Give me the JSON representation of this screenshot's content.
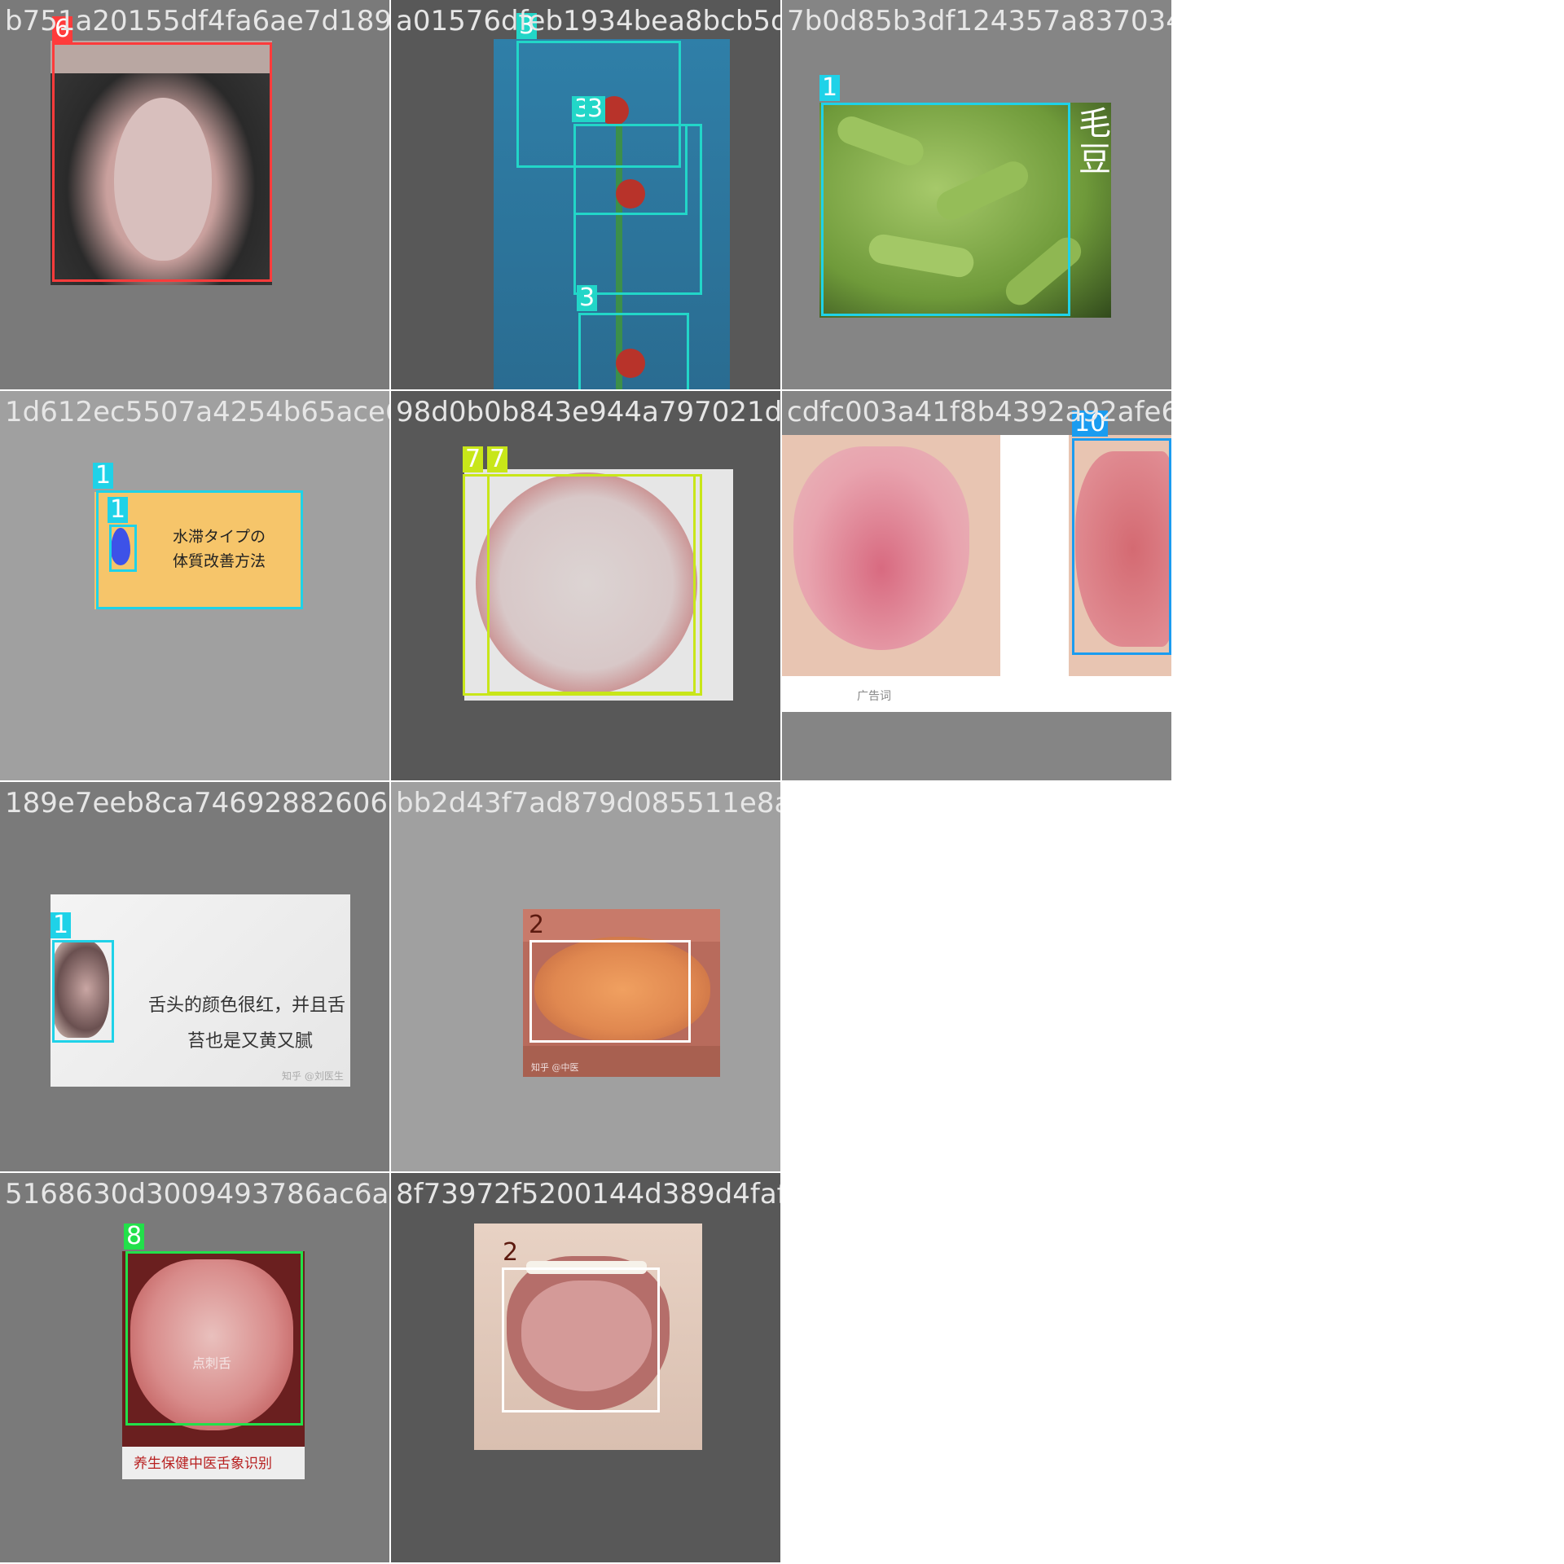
{
  "cells": [
    {
      "filename": "b751a20155df4fa6ae7d1892af2133afd.jpg",
      "tags": [
        "6"
      ]
    },
    {
      "filename": "a01576dfeb1934bea8bcb5d25a0657932f.jpg",
      "tags": [
        "3",
        "3",
        "3",
        "3"
      ]
    },
    {
      "filename": "7b0d85b3df124357a8370345b966f127.jpg",
      "tags": [
        "1"
      ],
      "image_text": "毛豆"
    },
    {
      "filename": "1d612ec5507a4254b65ace69d3bd4c0423.jpg",
      "tags": [
        "1",
        "1"
      ],
      "caption_lines": [
        "水滞タイプの",
        "体質改善方法"
      ]
    },
    {
      "filename": "98d0b0b843e944a797021d83bf40354.jpg",
      "tags": [
        "7",
        "7"
      ]
    },
    {
      "filename": "cdfc003a41f8b4392a92afe6095697ea1.jpg",
      "tags": [
        "10"
      ],
      "image_text": "广告词"
    },
    {
      "filename": "189e7eeb8ca74692882606062577e020.jpg",
      "tags": [
        "1"
      ],
      "caption_lines": [
        "舌头的颜色很红，并且舌",
        "苔也是又黄又腻"
      ],
      "watermark": "知乎 @刘医生"
    },
    {
      "filename": "bb2d43f7ad879d085511e8a7.jpg",
      "tags": [
        "2"
      ],
      "watermark": "知乎 @中医"
    },
    {
      "filename": "5168630d3009493786ac6a2b79a7a5e2.jpg",
      "tags": [
        "8"
      ],
      "image_text": "点刺舌",
      "bottom_text": "养生保健中医舌象识别"
    },
    {
      "filename": "8f73972f5200144d389d4faf8c5408ed5.jpg",
      "tags": [
        "2"
      ]
    }
  ],
  "colors": {
    "red": "#ff3b3b",
    "cyan": "#1fd2e8",
    "teal": "#22d6c8",
    "lime": "#c8e619",
    "blue": "#1a9cf0",
    "white": "#ffffff",
    "green": "#22e04a",
    "darkred": "#5c1a0f"
  }
}
